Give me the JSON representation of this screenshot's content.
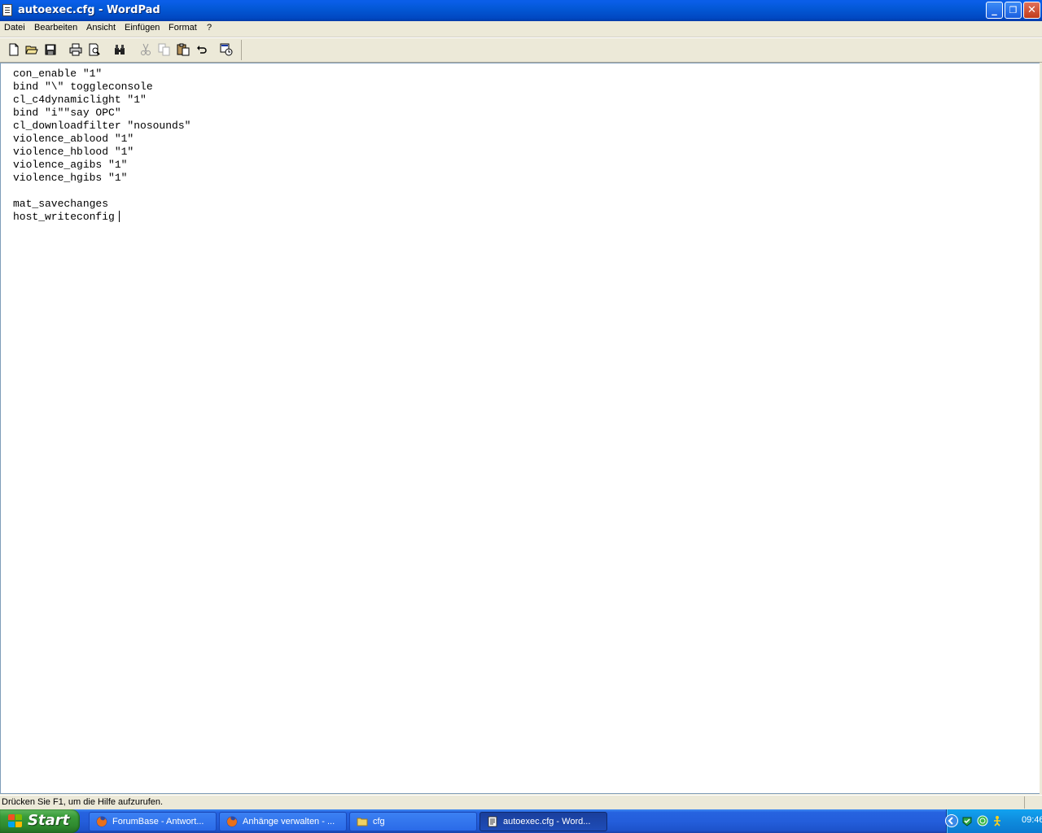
{
  "window": {
    "title": "autoexec.cfg - WordPad",
    "controls": {
      "minimize": "_",
      "maximize": "❐",
      "close": "✕"
    }
  },
  "menu": {
    "items": [
      "Datei",
      "Bearbeiten",
      "Ansicht",
      "Einfügen",
      "Format",
      "?"
    ]
  },
  "toolbar": {
    "icons": [
      "new-document-icon",
      "open-folder-icon",
      "save-icon",
      "print-icon",
      "print-preview-icon",
      "find-icon",
      "cut-icon",
      "copy-icon",
      "paste-icon",
      "undo-icon",
      "insert-date-time-icon"
    ]
  },
  "document": {
    "lines": [
      "con_enable \"1\"",
      "bind \"\\\" toggleconsole",
      "cl_c4dynamiclight \"1\"",
      "bind \"i\"\"say OPC\"",
      "cl_downloadfilter \"nosounds\"",
      "violence_ablood \"1\"",
      "violence_hblood \"1\"",
      "violence_agibs \"1\"",
      "violence_hgibs \"1\"",
      "",
      "mat_savechanges",
      "host_writeconfig"
    ]
  },
  "statusbar": {
    "text": "Drücken Sie F1, um die Hilfe aufzurufen."
  },
  "taskbar": {
    "start_label": "Start",
    "tasks": [
      {
        "label": "ForumBase - Antwort...",
        "icon": "firefox-icon"
      },
      {
        "label": "Anhänge verwalten - ...",
        "icon": "firefox-icon"
      },
      {
        "label": "cfg",
        "icon": "folder-icon"
      },
      {
        "label": "autoexec.cfg - Word...",
        "icon": "wordpad-icon"
      }
    ],
    "clock": "09:46"
  },
  "colors": {
    "titlebar": "#0358d6",
    "taskbar": "#245edb",
    "start": "#3a9c3a",
    "tray": "#0f8fe0"
  }
}
